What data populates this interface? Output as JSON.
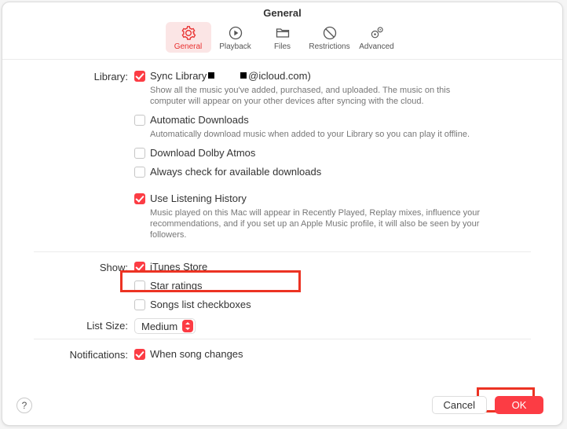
{
  "title": "General",
  "tabs": {
    "general": "General",
    "playback": "Playback",
    "files": "Files",
    "restrictions": "Restrictions",
    "advanced": "Advanced"
  },
  "labels": {
    "library": "Library:",
    "show": "Show:",
    "listSize": "List Size:",
    "notifications": "Notifications:"
  },
  "library": {
    "syncLibrary": {
      "label_a": "Sync Library",
      "label_b": "@icloud.com)",
      "checked": true
    },
    "syncLibrary_desc": "Show all the music you've added, purchased, and uploaded. The music on this computer will appear on your other devices after syncing with the cloud.",
    "autoDownloads": {
      "label": "Automatic Downloads",
      "checked": false
    },
    "autoDownloads_desc": "Automatically download music when added to your Library so you can play it offline.",
    "dolby": {
      "label": "Download Dolby Atmos",
      "checked": false
    },
    "alwaysCheck": {
      "label": "Always check for available downloads",
      "checked": false
    },
    "listening": {
      "label": "Use Listening History",
      "checked": true
    },
    "listening_desc": "Music played on this Mac will appear in Recently Played, Replay mixes, influence your recommendations, and if you set up an Apple Music profile, it will also be seen by your followers."
  },
  "show": {
    "itunes": {
      "label": "iTunes Store",
      "checked": true
    },
    "star": {
      "label": "Star ratings",
      "checked": false
    },
    "songs": {
      "label": "Songs list checkboxes",
      "checked": false
    }
  },
  "listSize": {
    "value": "Medium"
  },
  "notifications": {
    "songChanges": {
      "label": "When song changes",
      "checked": true
    }
  },
  "buttons": {
    "cancel": "Cancel",
    "ok": "OK",
    "help": "?"
  }
}
